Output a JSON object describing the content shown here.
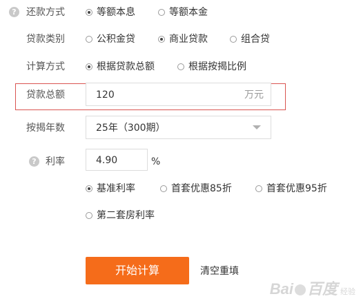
{
  "repay_method": {
    "label": "还款方式",
    "options": [
      {
        "label": "等额本息",
        "checked": true
      },
      {
        "label": "等额本金",
        "checked": false
      }
    ]
  },
  "loan_type": {
    "label": "贷款类别",
    "options": [
      {
        "label": "公积金贷",
        "checked": false
      },
      {
        "label": "商业贷款",
        "checked": true
      },
      {
        "label": "组合贷",
        "checked": false
      }
    ]
  },
  "calc_method": {
    "label": "计算方式",
    "options": [
      {
        "label": "根据贷款总额",
        "checked": true
      },
      {
        "label": "根据按揭比例",
        "checked": false
      }
    ]
  },
  "loan_amount": {
    "label": "贷款总额",
    "value": "120",
    "unit": "万元"
  },
  "loan_years": {
    "label": "按揭年数",
    "selected": "25年（300期）"
  },
  "interest_rate": {
    "label": "利率",
    "value": "4.90",
    "unit": "%",
    "options": [
      {
        "label": "基准利率",
        "checked": true
      },
      {
        "label": "首套优惠85折",
        "checked": false
      },
      {
        "label": "首套优惠95折",
        "checked": false
      },
      {
        "label": "第二套房利率",
        "checked": false
      }
    ]
  },
  "actions": {
    "calculate": "开始计算",
    "reset": "清空重填"
  },
  "help_icon_glyph": "?",
  "watermark": {
    "brand_left": "Bai",
    "brand_right": "百度",
    "sub": "经验"
  },
  "colors": {
    "accent": "#f56c1a",
    "highlight_border": "#d9534f"
  }
}
